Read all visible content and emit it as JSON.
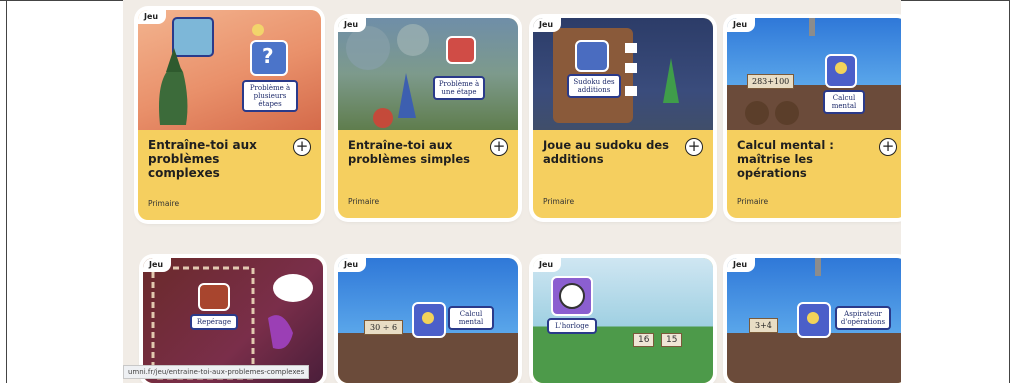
{
  "cards": [
    {
      "badge": "Jeu",
      "thumb_label": "Problème à plusieurs étapes",
      "title": "Entraîne-toi aux problèmes complexes",
      "level": "Primaire"
    },
    {
      "badge": "Jeu",
      "thumb_label": "Problème à une étape",
      "title": "Entraîne-toi aux problèmes simples",
      "level": "Primaire"
    },
    {
      "badge": "Jeu",
      "thumb_label": "Sudoku des additions",
      "title": "Joue au sudoku des additions",
      "level": "Primaire"
    },
    {
      "badge": "Jeu",
      "thumb_label": "Calcul mental",
      "thumb_text": "283+100",
      "title": "Calcul mental : maîtrise les opérations",
      "level": "Primaire"
    },
    {
      "badge": "Jeu",
      "thumb_label": "Repérage"
    },
    {
      "badge": "Jeu",
      "thumb_label": "Calcul mental",
      "thumb_text": "30 ÷ 6"
    },
    {
      "badge": "Jeu",
      "thumb_label": "L'horloge",
      "thumb_text_a": "16",
      "thumb_text_b": "15"
    },
    {
      "badge": "Jeu",
      "thumb_label": "Aspirateur d'opérations",
      "thumb_text": "3+4"
    }
  ],
  "plus_symbol": "+",
  "status_url": "umni.fr/jeu/entraine-toi-aux-problemes-complexes",
  "colors": {
    "card_yellow": "#f5cf5f",
    "label_border": "#2a3a8a"
  }
}
